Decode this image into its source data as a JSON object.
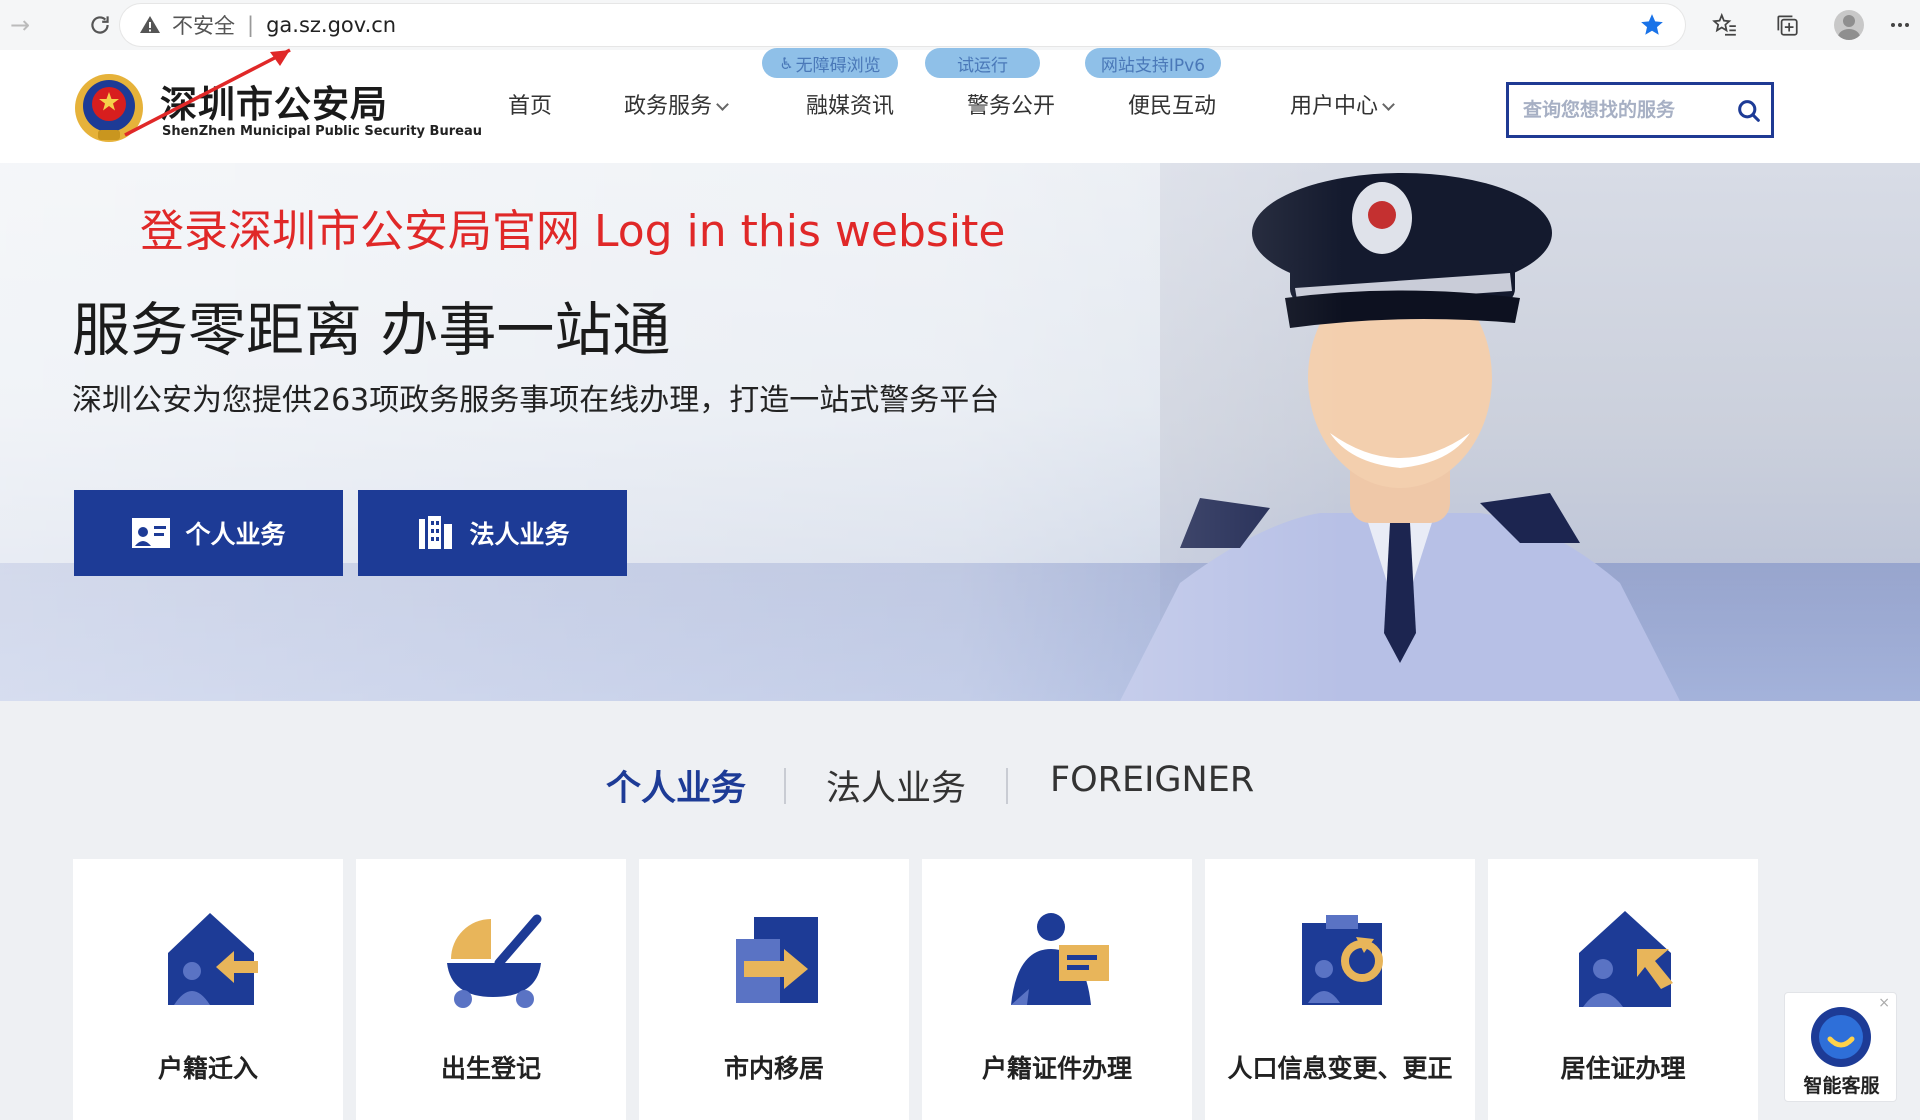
{
  "browser": {
    "insecure_label": "不安全",
    "separator": "|",
    "url": "ga.sz.gov.cn"
  },
  "site": {
    "name": "深圳市公安局",
    "name_en": "ShenZhen Municipal Public Security Bureau"
  },
  "nav": {
    "items": [
      {
        "label": "首页",
        "has_dropdown": false
      },
      {
        "label": "政务服务",
        "has_dropdown": true
      },
      {
        "label": "融媒资讯",
        "has_dropdown": false
      },
      {
        "label": "警务公开",
        "has_dropdown": false
      },
      {
        "label": "便民互动",
        "has_dropdown": false
      },
      {
        "label": "用户中心",
        "has_dropdown": true
      }
    ],
    "pills": [
      "无障碍浏览",
      "试运行",
      "网站支持IPv6"
    ]
  },
  "search": {
    "placeholder": "查询您想找的服务"
  },
  "annotation": {
    "text": "登录深圳市公安局官网 Log in this website"
  },
  "hero": {
    "title": "服务零距离 办事一站通",
    "subtitle": "深圳公安为您提供263项政务服务事项在线办理，打造一站式警务平台",
    "buttons": [
      {
        "label": "个人业务",
        "icon": "id-card-icon"
      },
      {
        "label": "法人业务",
        "icon": "building-icon"
      }
    ]
  },
  "tabs": [
    {
      "label": "个人业务",
      "active": true
    },
    {
      "label": "法人业务",
      "active": false
    },
    {
      "label": "FOREIGNER",
      "active": false
    }
  ],
  "services": [
    {
      "label": "户籍迁入",
      "icon": "house-arrow-in-icon"
    },
    {
      "label": "出生登记",
      "icon": "baby-stroller-icon"
    },
    {
      "label": "市内移居",
      "icon": "move-arrow-icon"
    },
    {
      "label": "户籍证件办理",
      "icon": "person-id-card-icon"
    },
    {
      "label": "人口信息变更、更正",
      "icon": "clipboard-refresh-icon"
    },
    {
      "label": "居住证办理",
      "icon": "house-flag-icon"
    }
  ],
  "widget": {
    "label": "智能客服",
    "close": "×"
  },
  "colors": {
    "primary": "#1d3b96",
    "accent_gold": "#e8b55a",
    "annotation_red": "#e02828",
    "pill_bg": "#8fc0e8"
  }
}
